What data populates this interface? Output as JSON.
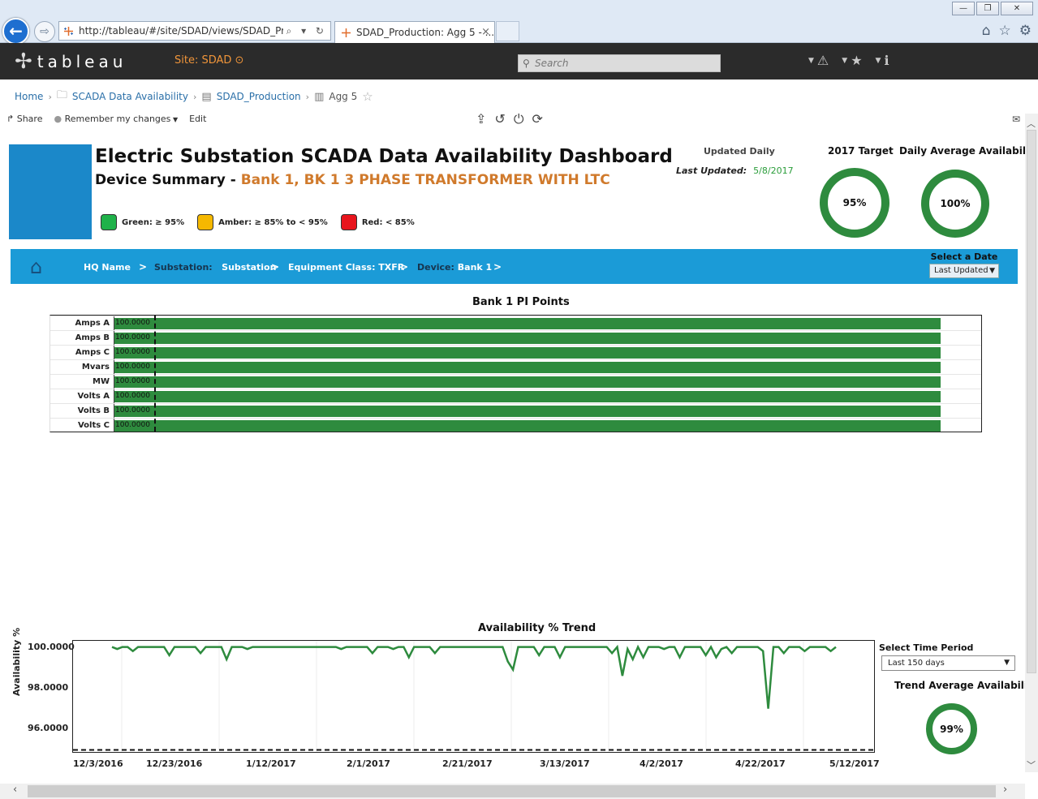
{
  "browser": {
    "url": "http://tableau/#/site/SDAD/views/SDAD_Produc",
    "tab_title": "SDAD_Production: Agg 5 - ...",
    "tab_close": "×",
    "back": "←",
    "forward": "⇨",
    "url_controls": "⌕ ▾ ↻",
    "min": "—",
    "max": "❐",
    "close": "✕",
    "home_icon": "⌂",
    "fav_icon": "☆",
    "gear_icon": "⚙"
  },
  "tableau": {
    "logo": "tableau",
    "site_label": "Site: SDAD ⊙",
    "search_placeholder": "Search",
    "alert_icon": "⚠",
    "star_icon": "★",
    "info_icon": "ℹ"
  },
  "breadcrumb": {
    "home": "Home",
    "project": "SCADA Data Availability",
    "workbook": "SDAD_Production",
    "view": "Agg 5"
  },
  "toolbar": {
    "share": "Share",
    "remember": "Remember my changes",
    "edit": "Edit"
  },
  "dashboard": {
    "title": "Electric Substation SCADA Data Availability Dashboard",
    "subtitle_prefix": "Device Summary - ",
    "subtitle_device": "Bank 1, BK 1 3 PHASE TRANSFORMER WITH LTC",
    "legend": [
      {
        "label": "Green: ≥ 95%",
        "color": "#1fb24a"
      },
      {
        "label": "Amber: ≥ 85% to < 95%",
        "color": "#f5b800"
      },
      {
        "label": "Red: < 85%",
        "color": "#e8141c"
      }
    ],
    "updated_daily": "Updated Daily",
    "last_updated_label": "Last Updated:",
    "last_updated_value": "5/8/2017",
    "target_label": "2017 Target",
    "target_value": "95%",
    "avg_label": "Daily Average Availability",
    "avg_value": "100%"
  },
  "nav": {
    "hq": "HQ Name",
    "substation_key": "Substation:",
    "substation_val": "Substation",
    "equip": "Equipment Class: TXFR",
    "device_key": "Device:",
    "device_val": "Bank 1",
    "date_label": "Select a Date",
    "date_value": "Last Updated"
  },
  "pi_chart": {
    "title": "Bank 1 PI Points",
    "rows": [
      {
        "label": "Amps A",
        "value": "100.0000"
      },
      {
        "label": "Amps B",
        "value": "100.0000"
      },
      {
        "label": "Amps C",
        "value": "100.0000"
      },
      {
        "label": "Mvars",
        "value": "100.0000"
      },
      {
        "label": "MW",
        "value": "100.0000"
      },
      {
        "label": "Volts A",
        "value": "100.0000"
      },
      {
        "label": "Volts B",
        "value": "100.0000"
      },
      {
        "label": "Volts C",
        "value": "100.0000"
      }
    ]
  },
  "trend": {
    "title": "Availability % Trend",
    "ylabel": "Availability %",
    "yticks": [
      "100.0000",
      "98.0000",
      "96.0000"
    ],
    "xticks": [
      "12/3/2016",
      "12/23/2016",
      "1/12/2017",
      "2/1/2017",
      "2/21/2017",
      "3/13/2017",
      "4/2/2017",
      "4/22/2017",
      "5/12/2017"
    ],
    "period_label": "Select Time Period",
    "period_value": "Last 150 days",
    "avg_label": "Trend Average Availability",
    "avg_value": "99%"
  },
  "chart_data": {
    "type": "line",
    "title": "Availability % Trend",
    "ylabel": "Availability %",
    "ylim": [
      94.9,
      100.3
    ],
    "target": 95,
    "series": [
      {
        "values": [
          100.0,
          99.9,
          100.0,
          100.0,
          99.8,
          100.0,
          100.0,
          100.0,
          100.0,
          100.0,
          100.0,
          99.6,
          100.0,
          100.0,
          100.0,
          100.0,
          100.0,
          99.7,
          100.0,
          100.0,
          100.0,
          100.0,
          99.4,
          100.0,
          100.0,
          100.0,
          99.9,
          100.0,
          100.0,
          100.0,
          100.0,
          100.0,
          100.0,
          100.0,
          100.0,
          100.0,
          100.0,
          100.0,
          100.0,
          100.0,
          100.0,
          100.0,
          100.0,
          100.0,
          99.9,
          100.0,
          100.0,
          100.0,
          100.0,
          100.0,
          99.7,
          100.0,
          100.0,
          100.0,
          99.9,
          100.0,
          100.0,
          99.5,
          100.0,
          100.0,
          100.0,
          100.0,
          99.7,
          100.0,
          100.0,
          100.0,
          100.0,
          100.0,
          100.0,
          100.0,
          100.0,
          100.0,
          100.0,
          100.0,
          100.0,
          100.0,
          99.3,
          98.9,
          100.0,
          100.0,
          100.0,
          100.0,
          99.6,
          100.0,
          100.0,
          100.0,
          99.5,
          100.0,
          100.0,
          100.0,
          100.0,
          100.0,
          100.0,
          100.0,
          100.0,
          100.0,
          99.7,
          100.0,
          98.6,
          99.9,
          99.4,
          100.0,
          99.5,
          100.0,
          100.0,
          100.0,
          99.9,
          100.0,
          100.0,
          99.5,
          100.0,
          100.0,
          100.0,
          100.0,
          99.6,
          100.0,
          99.5,
          99.9,
          100.0,
          99.7,
          100.0,
          100.0,
          100.0,
          100.0,
          100.0,
          99.8,
          97.0,
          100.0,
          100.0,
          99.7,
          100.0,
          100.0,
          100.0,
          99.8,
          100.0,
          100.0,
          100.0,
          100.0,
          99.8,
          100.0
        ]
      }
    ]
  }
}
